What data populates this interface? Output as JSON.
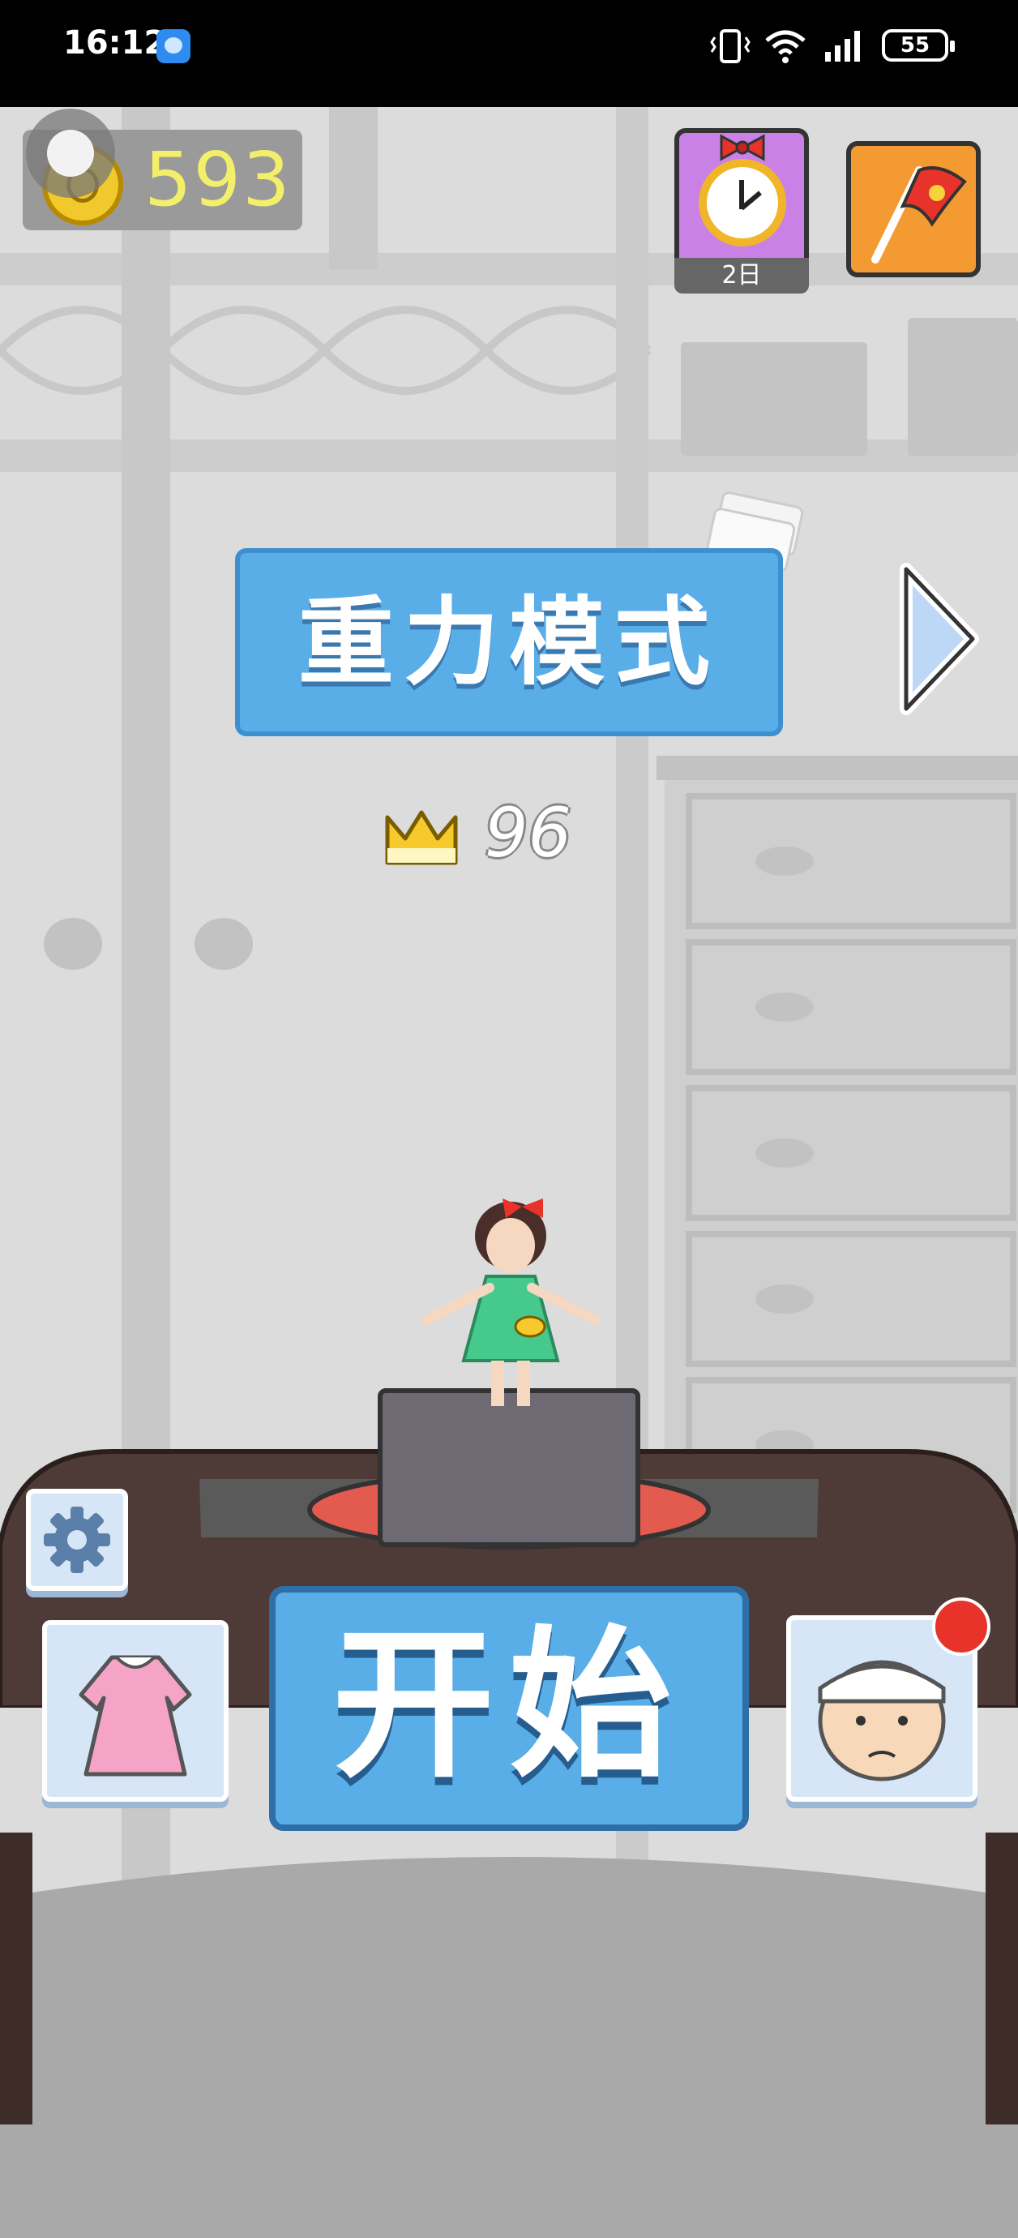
{
  "status_bar": {
    "time": "16:12",
    "battery": "55"
  },
  "hud": {
    "coins": "593",
    "daily_reward_label": "2日"
  },
  "mode": {
    "title": "重力模式",
    "best_score": "96"
  },
  "buttons": {
    "start_label": "开始"
  },
  "colors": {
    "button_blue": "#5aaee8",
    "coin_text": "#f3ef6a",
    "badge_red": "#e8332b",
    "daily_purple": "#c981e6",
    "flag_orange": "#f39a32"
  },
  "icons": [
    "settings-gear-icon",
    "dress-icon",
    "chef-icon",
    "crown-icon",
    "alarm-clock-icon",
    "flag-icon",
    "next-arrow-icon"
  ]
}
